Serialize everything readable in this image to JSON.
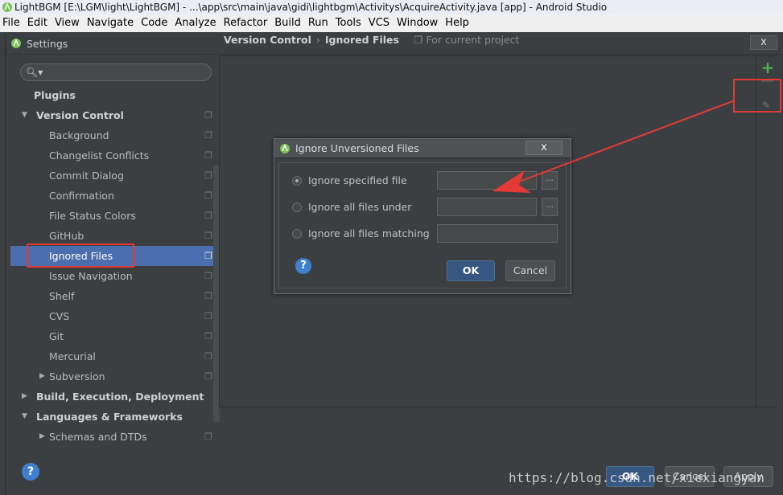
{
  "window": {
    "title": "LightBGM [E:\\LGM\\light\\LightBGM] - ...\\app\\src\\main\\java\\gidi\\lightbgm\\Activitys\\AcquireActivity.java [app] - Android Studio"
  },
  "menu": [
    "File",
    "Edit",
    "View",
    "Navigate",
    "Code",
    "Analyze",
    "Refactor",
    "Build",
    "Run",
    "Tools",
    "VCS",
    "Window",
    "Help"
  ],
  "settings": {
    "title": "Settings",
    "close": "x"
  },
  "sidebar": {
    "search_placeholder": "",
    "items": [
      {
        "label": "Plugins"
      },
      {
        "label": "Version Control"
      },
      {
        "label": "Background"
      },
      {
        "label": "Changelist Conflicts"
      },
      {
        "label": "Commit Dialog"
      },
      {
        "label": "Confirmation"
      },
      {
        "label": "File Status Colors"
      },
      {
        "label": "GitHub"
      },
      {
        "label": "Ignored Files"
      },
      {
        "label": "Issue Navigation"
      },
      {
        "label": "Shelf"
      },
      {
        "label": "CVS"
      },
      {
        "label": "Git"
      },
      {
        "label": "Mercurial"
      },
      {
        "label": "Subversion"
      },
      {
        "label": "Build, Execution, Deployment"
      },
      {
        "label": "Languages & Frameworks"
      },
      {
        "label": "Schemas and DTDs"
      }
    ]
  },
  "breadcrumb": {
    "part1": "Version Control",
    "separator": "›",
    "part2": "Ignored Files",
    "scope": "For current project"
  },
  "toolbar": {
    "add": "+"
  },
  "dialog": {
    "title": "Ignore Unversioned Files",
    "close": "x",
    "options": [
      {
        "label": "Ignore specified file",
        "selected": true
      },
      {
        "label": "Ignore all files under",
        "selected": false
      },
      {
        "label": "Ignore all files matching",
        "selected": false
      }
    ],
    "browse": "...",
    "help": "?",
    "ok": "OK",
    "cancel": "Cancel"
  },
  "footer": {
    "help": "?",
    "ok": "OK",
    "cancel": "Cancel",
    "apply": "Apply"
  },
  "watermark": "https://blog.csdn.net/xiexiangyan",
  "colors": {
    "background": "#3c3f41",
    "selection": "#4b6eaf",
    "annotation": "#e53935",
    "add": "#4caf50"
  }
}
